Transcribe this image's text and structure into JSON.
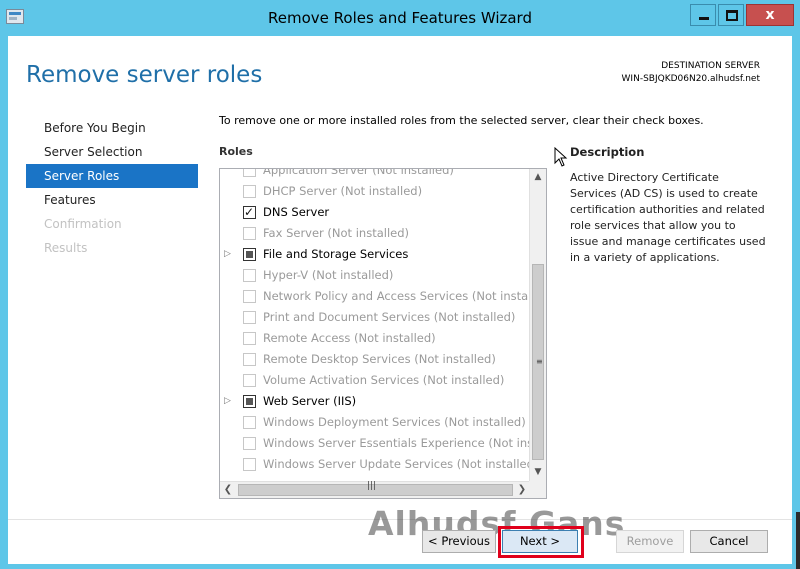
{
  "window": {
    "title": "Remove Roles and Features Wizard",
    "close_label": "x"
  },
  "header": {
    "page_title": "Remove server roles",
    "destination_label": "DESTINATION SERVER",
    "destination_server": "WIN-SBJQKD06N20.alhudsf.net"
  },
  "nav": {
    "items": [
      {
        "label": "Before You Begin",
        "state": "normal"
      },
      {
        "label": "Server Selection",
        "state": "normal"
      },
      {
        "label": "Server Roles",
        "state": "active"
      },
      {
        "label": "Features",
        "state": "normal"
      },
      {
        "label": "Confirmation",
        "state": "disabled"
      },
      {
        "label": "Results",
        "state": "disabled"
      }
    ]
  },
  "main": {
    "intro": "To remove one or more installed roles from the selected server, clear their check boxes.",
    "roles_label": "Roles",
    "roles": [
      {
        "label": "Application Server (Not installed)",
        "state": "none",
        "installed": false,
        "expandable": false
      },
      {
        "label": "DHCP Server (Not installed)",
        "state": "none",
        "installed": false,
        "expandable": false
      },
      {
        "label": "DNS Server",
        "state": "checked",
        "installed": true,
        "expandable": false
      },
      {
        "label": "Fax Server (Not installed)",
        "state": "none",
        "installed": false,
        "expandable": false
      },
      {
        "label": "File and Storage Services",
        "state": "partial",
        "installed": true,
        "expandable": true
      },
      {
        "label": "Hyper-V (Not installed)",
        "state": "none",
        "installed": false,
        "expandable": false
      },
      {
        "label": "Network Policy and Access Services (Not installed)",
        "state": "none",
        "installed": false,
        "expandable": false
      },
      {
        "label": "Print and Document Services (Not installed)",
        "state": "none",
        "installed": false,
        "expandable": false
      },
      {
        "label": "Remote Access (Not installed)",
        "state": "none",
        "installed": false,
        "expandable": false
      },
      {
        "label": "Remote Desktop Services (Not installed)",
        "state": "none",
        "installed": false,
        "expandable": false
      },
      {
        "label": "Volume Activation Services (Not installed)",
        "state": "none",
        "installed": false,
        "expandable": false
      },
      {
        "label": "Web Server (IIS)",
        "state": "partial",
        "installed": true,
        "expandable": true
      },
      {
        "label": "Windows Deployment Services (Not installed)",
        "state": "none",
        "installed": false,
        "expandable": false
      },
      {
        "label": "Windows Server Essentials Experience (Not installed)",
        "state": "none",
        "installed": false,
        "expandable": false
      },
      {
        "label": "Windows Server Update Services (Not installed)",
        "state": "none",
        "installed": false,
        "expandable": false
      }
    ]
  },
  "description": {
    "title": "Description",
    "text": "Active Directory Certificate Services (AD CS) is used to create certification authorities and related role services that allow you to issue and manage certificates used in a variety of applications."
  },
  "footer": {
    "previous": "< Previous",
    "next": "Next >",
    "remove": "Remove",
    "cancel": "Cancel"
  },
  "watermark": "Alhudsf Gans",
  "colors": {
    "titlebar": "#5ec6e8",
    "accent": "#1a74c6",
    "close": "#c7504f",
    "highlight": "#e0001b"
  }
}
